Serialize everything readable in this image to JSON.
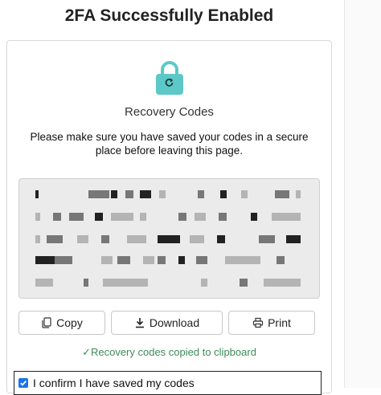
{
  "page": {
    "title": "2FA Successfully Enabled",
    "heading": "Recovery Codes",
    "note": "Please make sure you have saved your codes in a secure place before leaving this page."
  },
  "codes": {
    "state": "obscured",
    "lines": 5
  },
  "actions": {
    "copy_label": "Copy",
    "download_label": "Download",
    "print_label": "Print"
  },
  "status": {
    "message": "✓Recovery codes copied to clipboard",
    "color": "#3d8b5a"
  },
  "confirm": {
    "label": "I confirm I have saved my codes",
    "checked": true
  },
  "colors": {
    "lock": "#5cc8c8",
    "checkbox": "#1a73e8"
  }
}
